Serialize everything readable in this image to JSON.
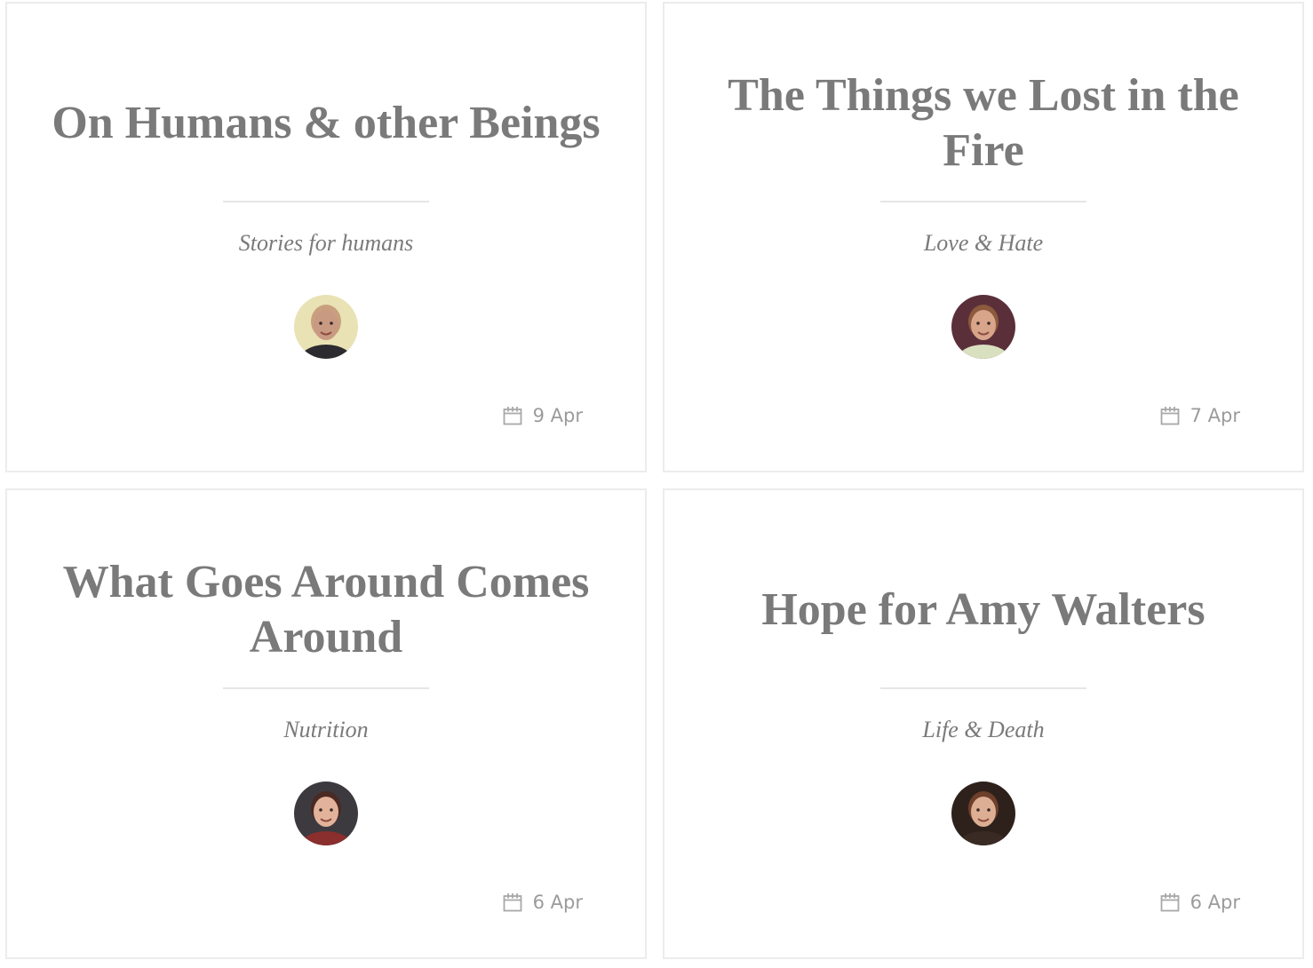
{
  "posts": [
    {
      "title": "On Humans & other Beings",
      "category": "Stories for humans",
      "date": "9 Apr",
      "avatar": {
        "bg": "#e9e2b4",
        "skin": "#c99a82",
        "hair": "#c9a07f",
        "shirt": "#2b2b30"
      }
    },
    {
      "title": "The Things we Lost in the Fire",
      "category": "Love & Hate",
      "date": "7 Apr",
      "avatar": {
        "bg": "#5a2f3a",
        "skin": "#d8a58a",
        "hair": "#8c5a3c",
        "shirt": "#d9e0c0"
      }
    },
    {
      "title": "What Goes Around Comes Around",
      "category": "Nutrition",
      "date": "6 Apr",
      "avatar": {
        "bg": "#3c3a3f",
        "skin": "#e2b39a",
        "hair": "#4a2a22",
        "shirt": "#8a2e2e"
      }
    },
    {
      "title": "Hope for Amy Walters",
      "category": "Life & Death",
      "date": "6 Apr",
      "avatar": {
        "bg": "#2e211c",
        "skin": "#dcae94",
        "hair": "#6e3f2a",
        "shirt": "#3a2a24"
      }
    }
  ],
  "icons": {
    "date": "calendar-icon",
    "author": "avatar"
  },
  "colors": {
    "text": "#7a7a7a",
    "meta": "#9b9b9b",
    "border": "#ececec"
  }
}
